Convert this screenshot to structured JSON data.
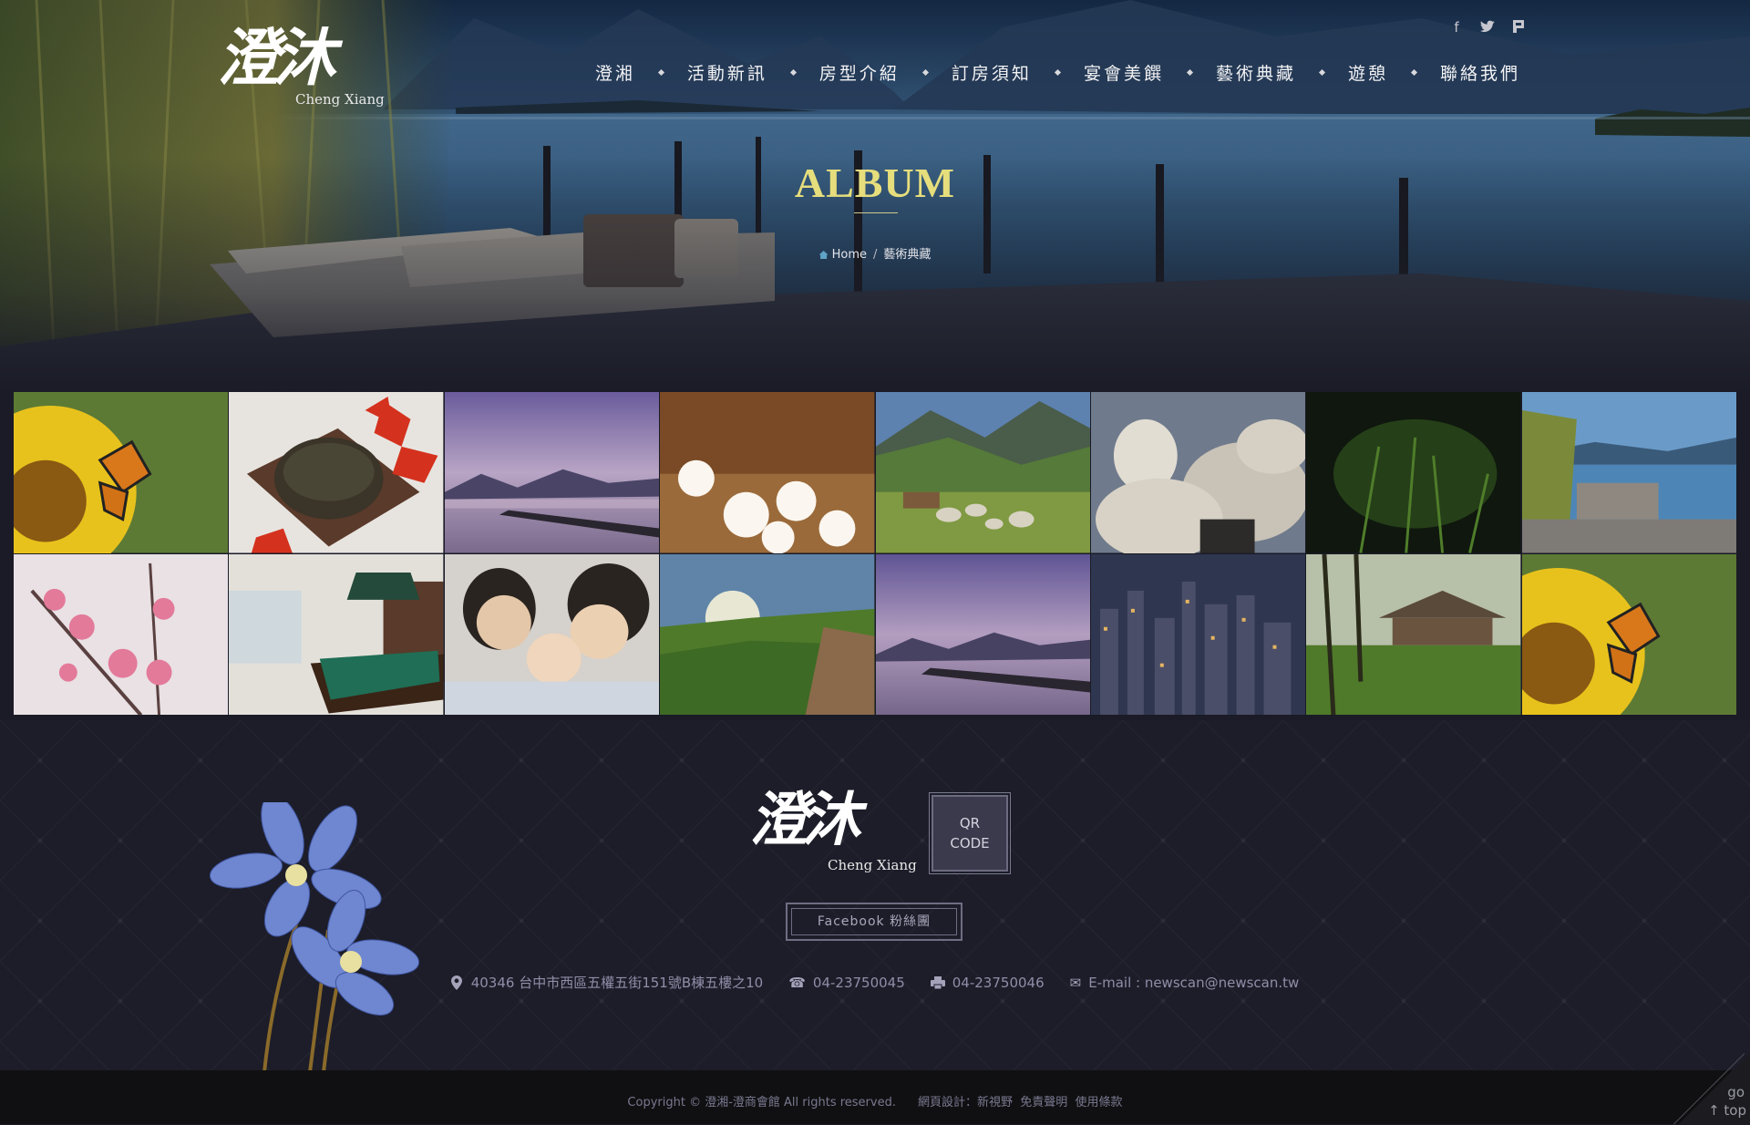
{
  "brand": {
    "name_cn": "澄沐",
    "name_en": "Cheng Xiang"
  },
  "social": [
    {
      "icon": "facebook-icon",
      "glyph": "f"
    },
    {
      "icon": "twitter-icon",
      "glyph": "🐦"
    },
    {
      "icon": "flag-icon",
      "glyph": "⚑"
    }
  ],
  "nav": [
    {
      "label": "澄湘"
    },
    {
      "label": "活動新訊"
    },
    {
      "label": "房型介紹"
    },
    {
      "label": "訂房須知"
    },
    {
      "label": "宴會美饌"
    },
    {
      "label": "藝術典藏"
    },
    {
      "label": "遊憩"
    },
    {
      "label": "聯絡我們"
    }
  ],
  "hero": {
    "title": "ALBUM",
    "breadcrumb_home": "Home",
    "breadcrumb_sep": "/",
    "breadcrumb_current": "藝術典藏"
  },
  "gallery": [
    "sunflower-butterfly",
    "tea-bowl-maple",
    "lake-pier-dusk",
    "white-blossoms",
    "mountain-pasture-sheep",
    "sheep-closeup",
    "dark-grass",
    "lake-terrace",
    "cherry-blossom",
    "billiard-room",
    "family-portrait",
    "forest-valley-sun",
    "lake-pier-dusk-2",
    "city-night",
    "garden-pavilion",
    "sunflower-butterfly-2"
  ],
  "footer": {
    "qr_line1": "QR",
    "qr_line2": "CODE",
    "facebook_label": "Facebook 粉絲團",
    "address": "40346 台中市西區五權五街151號B棟五樓之10",
    "phone": "04-23750045",
    "fax": "04-23750046",
    "email": "E-mail : newscan@newscan.tw",
    "copyright": "Copyright © 澄湘-澄商會館 All rights reserved.",
    "design": "網頁設計：新視野",
    "disclaimer": "免責聲明",
    "terms": "使用條款",
    "gotop_1": "go",
    "gotop_2": "↑ top"
  },
  "colors": {
    "accent_title": "#e6de7c",
    "background": "#1a1b26",
    "footer_text": "#8f8ea8"
  }
}
